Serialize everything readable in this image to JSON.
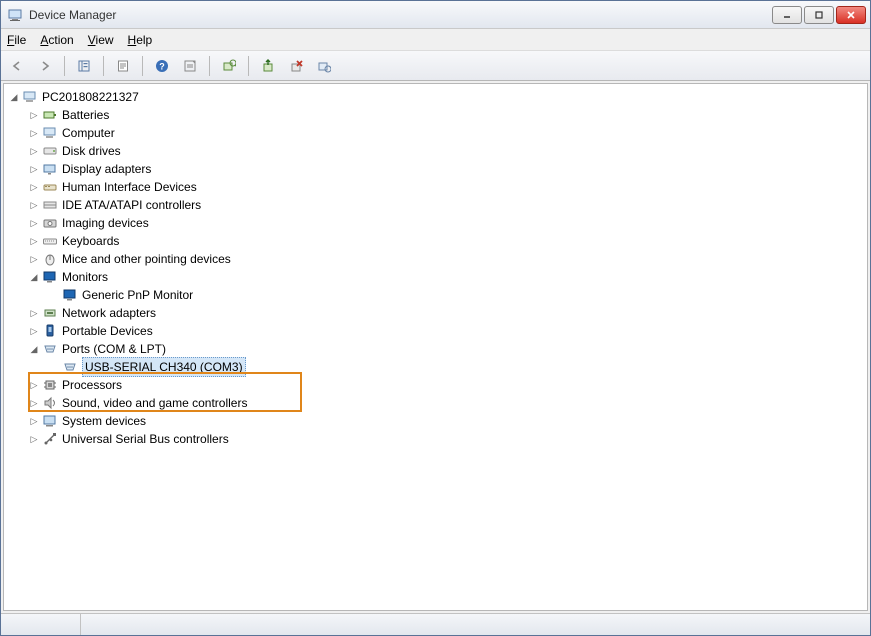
{
  "window": {
    "title": "Device Manager"
  },
  "menus": {
    "file": "File",
    "action": "Action",
    "view": "View",
    "help": "Help"
  },
  "tree": {
    "root": "PC201808221327",
    "batteries": "Batteries",
    "computer": "Computer",
    "disk_drives": "Disk drives",
    "display_adapters": "Display adapters",
    "hid": "Human Interface Devices",
    "ide": "IDE ATA/ATAPI controllers",
    "imaging": "Imaging devices",
    "keyboards": "Keyboards",
    "mice": "Mice and other pointing devices",
    "monitors": "Monitors",
    "monitor_generic": "Generic PnP Monitor",
    "network": "Network adapters",
    "portable": "Portable Devices",
    "ports": "Ports (COM & LPT)",
    "ports_ch340": "USB-SERIAL CH340 (COM3)",
    "processors": "Processors",
    "sound": "Sound, video and game controllers",
    "system": "System devices",
    "usb": "Universal Serial Bus controllers"
  }
}
